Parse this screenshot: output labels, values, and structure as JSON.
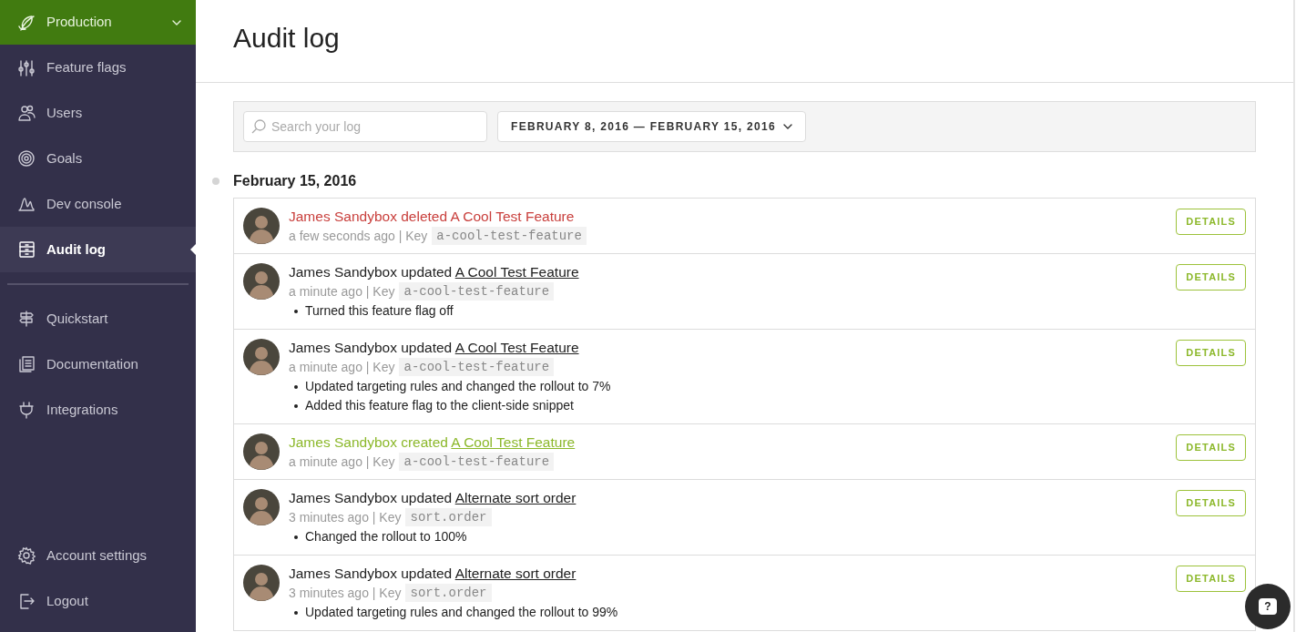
{
  "sidebar": {
    "environment": {
      "label": "Production"
    },
    "items": [
      {
        "label": "Feature flags",
        "selected": false
      },
      {
        "label": "Users",
        "selected": false
      },
      {
        "label": "Goals",
        "selected": false
      },
      {
        "label": "Dev console",
        "selected": false
      },
      {
        "label": "Audit log",
        "selected": true
      }
    ],
    "secondary_items": [
      {
        "label": "Quickstart"
      },
      {
        "label": "Documentation"
      },
      {
        "label": "Integrations"
      }
    ],
    "bottom_items": [
      {
        "label": "Account settings"
      },
      {
        "label": "Logout"
      }
    ]
  },
  "page": {
    "title": "Audit log"
  },
  "filters": {
    "search": {
      "placeholder": "Search your log"
    },
    "date_range": "FEBRUARY 8, 2016 — FEBRUARY 15, 2016"
  },
  "date_heading": "February 15, 2016",
  "entries": [
    {
      "kind": "deleted",
      "actor": "James Sandybox",
      "action": "deleted",
      "target": "A Cool Test Feature",
      "meta": "a few seconds ago | Key",
      "key": "a-cool-test-feature",
      "button": "DETAILS"
    },
    {
      "kind": "updated",
      "actor": "James Sandybox",
      "action": "updated",
      "target": "A Cool Test Feature",
      "meta": "a minute ago | Key",
      "key": "a-cool-test-feature",
      "changes": [
        "Turned this feature flag off"
      ],
      "button": "DETAILS"
    },
    {
      "kind": "updated",
      "actor": "James Sandybox",
      "action": "updated",
      "target": "A Cool Test Feature",
      "meta": "a minute ago | Key",
      "key": "a-cool-test-feature",
      "changes": [
        "Updated targeting rules and changed the rollout to 7%",
        "Added this feature flag to the client-side snippet"
      ],
      "button": "DETAILS"
    },
    {
      "kind": "created",
      "actor": "James Sandybox",
      "action": "created",
      "target": "A Cool Test Feature",
      "meta": "a minute ago | Key",
      "key": "a-cool-test-feature",
      "button": "DETAILS"
    },
    {
      "kind": "updated",
      "actor": "James Sandybox",
      "action": "updated",
      "target": "Alternate sort order",
      "meta": "3 minutes ago | Key",
      "key": "sort.order",
      "changes": [
        "Changed the rollout to 100%"
      ],
      "button": "DETAILS"
    },
    {
      "kind": "updated",
      "actor": "James Sandybox",
      "action": "updated",
      "target": "Alternate sort order",
      "meta": "3 minutes ago | Key",
      "key": "sort.order",
      "changes": [
        "Updated targeting rules and changed the rollout to 99%"
      ],
      "button": "DETAILS"
    }
  ],
  "help_button": "?"
}
